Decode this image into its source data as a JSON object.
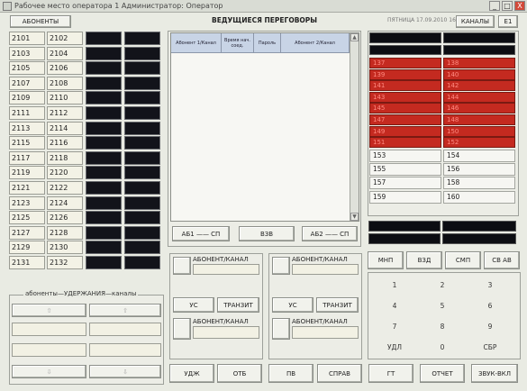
{
  "window": {
    "title": "Рабочее место оператора 1 Администратор: Оператор",
    "min": "_",
    "max": "□",
    "close": "X"
  },
  "top": {
    "subscribers_btn": "АБОНЕНТЫ",
    "title": "ВЕДУЩИЕСЯ ПЕРЕГОВОРЫ",
    "status": "ПЯТНИЦА 17.09.2010 16:40",
    "channels_btn": "КАНАЛЫ",
    "e1_btn": "Е1"
  },
  "subscribers": {
    "left": [
      "2101",
      "2103",
      "2105",
      "2107",
      "2109",
      "2111",
      "2113",
      "2115",
      "2117",
      "2119",
      "2121",
      "2123",
      "2125",
      "2127",
      "2129",
      "2131"
    ],
    "right": [
      "2102",
      "2104",
      "2106",
      "2108",
      "2110",
      "2112",
      "2114",
      "2116",
      "2118",
      "2120",
      "2122",
      "2124",
      "2126",
      "2128",
      "2130",
      "2132"
    ]
  },
  "holds": {
    "label": "абоненты—УДЕРЖАНИЯ—каналы",
    "up": "⇧",
    "down": "⇩"
  },
  "talks": {
    "columns": [
      "Абонент 1/Канал",
      "Время нач. соед.",
      "Пароль",
      "Абонент 2/Канал"
    ],
    "scroll_up": "▲",
    "scroll_down": "▼",
    "btn_ab1": "АБ1 —— СП",
    "btn_vzv": "ВЗВ",
    "btn_ab2": "АБ2 —— СП"
  },
  "calls": {
    "left_panel": {
      "ab_top": "АБОНЕНТ/КАНАЛ",
      "us": "УС",
      "transit": "ТРАНЗИТ",
      "ab_bottom": "АБОНЕНТ/КАНАЛ"
    },
    "right_panel": {
      "ab_top": "АБОНЕНТ/КАНАЛ",
      "us": "УС",
      "transit": "ТРАНЗИТ",
      "ab_bottom": "АБОНЕНТ/КАНАЛ"
    }
  },
  "channels": {
    "red_left": [
      "137",
      "139",
      "141",
      "143",
      "145",
      "147",
      "149",
      "151"
    ],
    "red_right": [
      "138",
      "140",
      "142",
      "144",
      "146",
      "148",
      "150",
      "152"
    ],
    "white_left": [
      "153",
      "155",
      "157",
      "159"
    ],
    "white_right": [
      "154",
      "156",
      "158",
      "160"
    ]
  },
  "function_keys": [
    "МНП",
    "ВЗД",
    "СМП",
    "СВ АВ"
  ],
  "keypad": [
    "1",
    "2",
    "3",
    "4",
    "5",
    "6",
    "7",
    "8",
    "9",
    "УДЛ",
    "0",
    "СБР"
  ],
  "bottom_bar": [
    "УДЖ",
    "ОТБ",
    "ПВ",
    "СПРАВ",
    "ГТ",
    "ОТЧЕТ",
    "ЗВУК-ВКЛ"
  ],
  "colors": {
    "red": "#c42a20",
    "dark": "#12131a",
    "cell": "#f3f2e6",
    "header_blue": "#c8d4e6"
  }
}
